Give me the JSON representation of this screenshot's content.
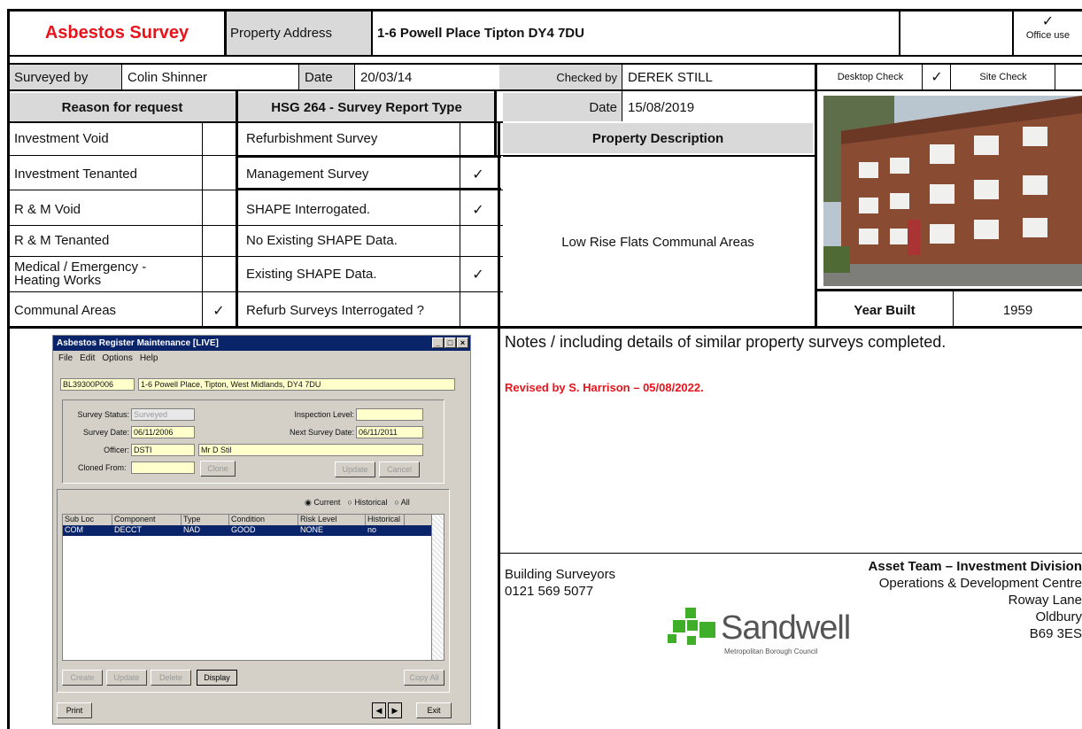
{
  "header": {
    "title": "Asbestos Survey",
    "property_address_label": "Property Address",
    "property_address": "1-6 Powell Place Tipton DY4 7DU",
    "office_use_tick": "✓",
    "office_use_label": "Office use"
  },
  "row2": {
    "surveyed_by_label": "Surveyed by",
    "surveyed_by": "Colin Shinner",
    "date_label": "Date",
    "date": "20/03/14",
    "checked_by_label": "Checked by",
    "checked_by": "DEREK STILL",
    "desktop_check_label": "Desktop Check",
    "desktop_check_tick": "✓",
    "site_check_label": "Site Check"
  },
  "reason": {
    "header": "Reason for request",
    "items": [
      {
        "label": "Investment Void",
        "tick": ""
      },
      {
        "label": "Investment Tenanted",
        "tick": ""
      },
      {
        "label": "R & M Void",
        "tick": ""
      },
      {
        "label": "R & M Tenanted",
        "tick": ""
      },
      {
        "label": "Medical / Emergency - Heating Works",
        "tick": ""
      },
      {
        "label": "Communal Areas",
        "tick": "✓"
      }
    ]
  },
  "hsg": {
    "header": "HSG 264 - Survey Report Type",
    "items": [
      {
        "label": "Refurbishment Survey",
        "tick": ""
      },
      {
        "label": "Management Survey",
        "tick": "✓"
      },
      {
        "label": "SHAPE Interrogated.",
        "tick": "✓"
      },
      {
        "label": "No Existing SHAPE Data.",
        "tick": ""
      },
      {
        "label": "Existing SHAPE Data.",
        "tick": "✓"
      },
      {
        "label": "Refurb Surveys Interrogated ?",
        "tick": ""
      }
    ]
  },
  "check_date": {
    "label": "Date",
    "value": "15/08/2019"
  },
  "property": {
    "header": "Property Description",
    "description": "Low Rise Flats Communal Areas",
    "year_built_label": "Year Built",
    "year_built": "1959"
  },
  "notes": {
    "heading_bold": "Notes",
    "heading_rest": " / including details of similar property surveys completed.",
    "revised": "Revised by S. Harrison – 05/08/2022."
  },
  "footer": {
    "dept": "Building Surveyors",
    "phone": "0121 569 5077",
    "team": "Asset Team – Investment Division",
    "addr1": "Operations & Development Centre",
    "addr2": "Roway Lane",
    "addr3": "Oldbury",
    "addr4": "B69 3ES",
    "logo_name": "Sandwell",
    "logo_sub": "Metropolitan Borough Council"
  },
  "app": {
    "title": "Asbestos Register Maintenance [LIVE]",
    "menu": [
      "File",
      "Edit",
      "Options",
      "Help"
    ],
    "ref": "BL39300P006",
    "address": "1-6 Powell Place, Tipton, West Midlands, DY4 7DU",
    "survey_status_label": "Survey Status:",
    "survey_status": "Surveyed",
    "inspection_level_label": "Inspection Level:",
    "inspection_level": "",
    "survey_date_label": "Survey Date:",
    "survey_date": "06/11/2006",
    "next_survey_label": "Next Survey Date:",
    "next_survey": "06/11/2011",
    "officer_label": "Officer:",
    "officer_code": "DSTI",
    "officer_name": "Mr D Stil",
    "cloned_label": "Cloned From:",
    "cloned": "",
    "clone_btn": "Clone",
    "update_btn": "Update",
    "cancel_btn": "Cancel",
    "radios": [
      {
        "label": "Current",
        "checked": true
      },
      {
        "label": "Historical",
        "checked": false
      },
      {
        "label": "All",
        "checked": false
      }
    ],
    "columns": [
      "Sub Loc",
      "Component",
      "Type",
      "Condition",
      "Risk Level",
      "Historical"
    ],
    "rows": [
      [
        "COM",
        "DECCT",
        "NAD",
        "GOOD",
        "NONE",
        "no"
      ]
    ],
    "buttons": [
      "Create",
      "Update",
      "Delete",
      "Display",
      "Copy All"
    ],
    "print_btn": "Print",
    "exit_btn": "Exit"
  },
  "colors": {
    "title_red": "#e8141c",
    "revised_red": "#e8141c",
    "header_gray": "#d9d9d9",
    "app_title_bar": "#0a246a",
    "field_yellow": "#ffffcc",
    "logo_green": "#3fae29"
  }
}
